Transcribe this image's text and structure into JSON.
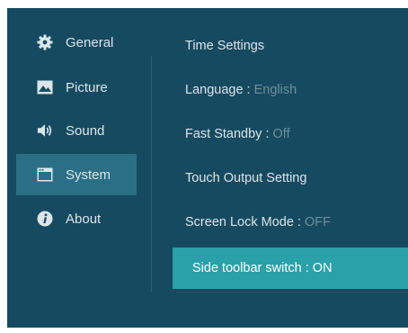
{
  "sidebar": {
    "items": [
      {
        "label": "General",
        "icon": "gear-icon"
      },
      {
        "label": "Picture",
        "icon": "image-icon"
      },
      {
        "label": "Sound",
        "icon": "speaker-icon"
      },
      {
        "label": "System",
        "icon": "monitor-icon",
        "active": true
      },
      {
        "label": "About",
        "icon": "info-icon"
      }
    ]
  },
  "settings": {
    "time": {
      "label": "Time Settings"
    },
    "language": {
      "label": "Language : ",
      "value": "English"
    },
    "fast_standby": {
      "label": "Fast Standby : ",
      "value": "Off"
    },
    "touch_output": {
      "label": "Touch Output Setting"
    },
    "screen_lock": {
      "label": "Screen Lock Mode : ",
      "value": "OFF"
    },
    "side_toolbar": {
      "label": "Side toolbar switch : ",
      "value": "ON",
      "selected": true
    }
  },
  "colors": {
    "background": "#164a61",
    "active_nav": "#2a6f86",
    "selected_row": "#2aa0a8",
    "text": "#dbe6ea",
    "dim_value": "#6f8f9c"
  }
}
